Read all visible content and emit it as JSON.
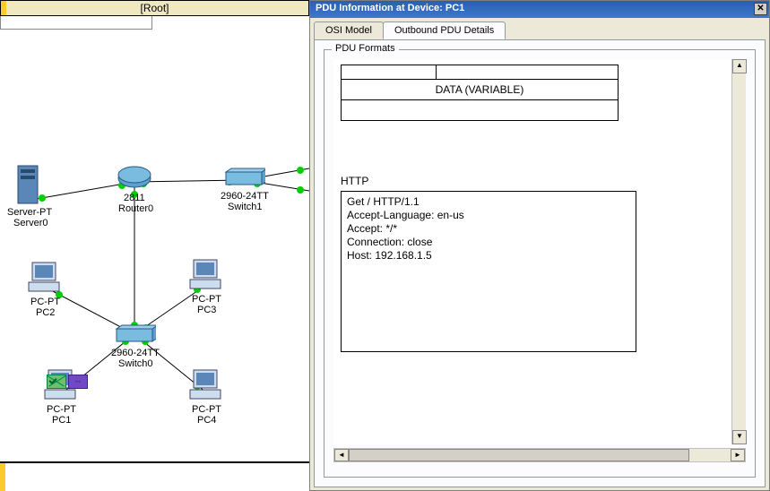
{
  "root": {
    "title": "[Root]"
  },
  "devices": {
    "server0_l1": "Server-PT",
    "server0_l2": "Server0",
    "router0_l1": "2811",
    "router0_l2": "Router0",
    "switch1_l1": "2960-24TT",
    "switch1_l2": "Switch1",
    "switch0_l1": "2960-24TT",
    "switch0_l2": "Switch0",
    "pc1_l1": "PC-PT",
    "pc1_l2": "PC1",
    "pc2_l1": "PC-PT",
    "pc2_l2": "PC2",
    "pc3_l1": "PC-PT",
    "pc3_l2": "PC3",
    "pc4_l1": "PC-PT",
    "pc4_l2": "PC4"
  },
  "panel": {
    "title": "PDU Information at Device: PC1",
    "tabs": {
      "osi": "OSI Model",
      "outbound": "Outbound PDU Details"
    },
    "fieldset": "PDU Formats",
    "data_row": "DATA (VARIABLE)",
    "http_title": "HTTP",
    "http_body": "Get / HTTP/1.1\nAccept-Language:  en-us\nAccept:  */*\nConnection: close\nHost: 192.168.1.5"
  }
}
